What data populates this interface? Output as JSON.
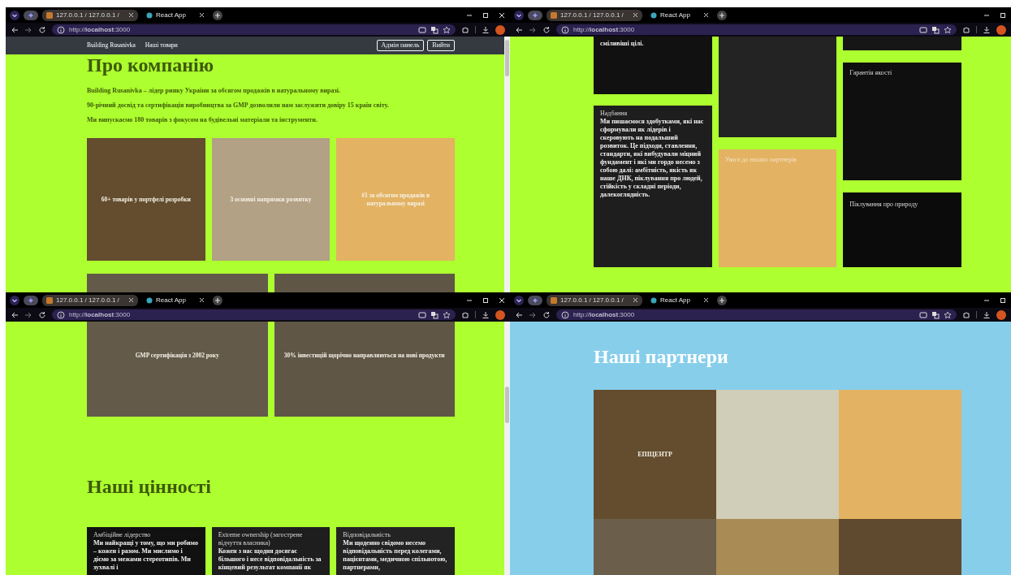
{
  "windows": [
    {
      "tabs": [
        {
          "title": "127.0.0.1 / 127.0.0.1 /",
          "selected": false
        },
        {
          "title": "React App",
          "selected": true
        }
      ],
      "url": "http://**localhost**:3000",
      "blocks": [
        {
          "kind": "navbar",
          "links": [
            "Building Rusanivka",
            "Наші товари"
          ],
          "buttons": [
            "Адмін панель",
            "Вийти"
          ]
        },
        {
          "kind": "heading",
          "text": "Про компанію"
        },
        {
          "kind": "paragraphs",
          "items": [
            "Building Rusanivka – лідер ринку України за обсягом продажів в натуральному виразі.",
            "90-річний досвід та сертифікація виробництва за GMP дозволили нам заслужити довіру 15 країн світу.",
            "Ми випускаємо 180 товарів з фокусом на будівельні матеріали та інструменти."
          ]
        },
        {
          "kind": "tiles",
          "tiles": [
            {
              "text": "60+ товарів у портфелі розробки",
              "color": "#634d2e"
            },
            {
              "text": "3 основні напрямки розвитку",
              "color": "#b2a185"
            },
            {
              "text": "#1 за обсягом продажів в натуральному виразі",
              "color": "#e3b262"
            }
          ]
        },
        {
          "kind": "tiles",
          "tiles": [
            {
              "color": "#635a4a"
            },
            {
              "color": "#5f5646"
            }
          ]
        }
      ]
    },
    {
      "tabs": [
        {
          "title": "127.0.0.1 / 127.0.0.1 /",
          "selected": false
        },
        {
          "title": "React App",
          "selected": true
        }
      ],
      "url": "http://**localhost**:3000",
      "blocks": [
        {
          "kind": "value_cards",
          "columns": [
            {
              "cards": [
                {
                  "text": "сміливіші цілі.",
                  "color": "#111111"
                },
                {
                  "title": "Надбання",
                  "text": "Ми пишаємося здобутками, які нас сформували як лідерів і скеровують на подальший розвиток. Це підходи, ставлення, стандарти, які вибудували міцний фундамент і які ми гордо несемо з собою далі: амбітність, якість як наше ДНК, піклування про людей, стійкість у складні періоди, далекоглядність.",
                  "color": "#1e1e1e"
                }
              ]
            },
            {
              "cards": [
                {
                  "color": "#232323"
                },
                {
                  "title": "Увага до наших партнерів",
                  "color": "#e3b262"
                }
              ]
            },
            {
              "cards": [
                {
                  "color": "#161616"
                },
                {
                  "title": "Гарантія якості",
                  "color": "#0f0f0f"
                },
                {
                  "title": "Піклування про природу",
                  "color": "#0b0b0b"
                }
              ]
            }
          ]
        }
      ]
    },
    {
      "tabs": [
        {
          "title": "127.0.0.1 / 127.0.0.1 /",
          "selected": false
        },
        {
          "title": "React App",
          "selected": true
        }
      ],
      "url": "http://**localhost**:3000",
      "blocks": [
        {
          "kind": "tiles",
          "tiles": [
            {
              "text": "GMP сертифікація з 2002 року",
              "color": "#635a4a"
            },
            {
              "text": "30% інвестицій щорічно направляються на нові продукти",
              "color": "#5f5646"
            }
          ]
        },
        {
          "kind": "heading",
          "text": "Наші цінності"
        },
        {
          "kind": "value_cards",
          "columns": [
            {
              "cards": [
                {
                  "title": "Амбіційне лідерство",
                  "text": "Ми найкращі у тому, що ми робимо – кожен і разом. Ми мислимо і діємо за межами стереотипів. Ми зухвалі і",
                  "color": "#111111"
                }
              ]
            },
            {
              "cards": [
                {
                  "title": "Extreme ownership (загострене відчуття власника)",
                  "text": "Кожен з нас щодня досягає більшого і несе відповідальність за кінцевий результат компанії як",
                  "color": "#1e1e1e"
                }
              ]
            },
            {
              "cards": [
                {
                  "title": "Відповідальність",
                  "text": "Ми щоденно свідомо несемо відповідальність перед колегами, пацієнтами, медичною спільнотою, партнерами,",
                  "color": "#232323"
                }
              ]
            }
          ]
        }
      ]
    },
    {
      "tabs": [
        {
          "title": "127.0.0.1 / 127.0.0.1 /",
          "selected": false
        },
        {
          "title": "React App",
          "selected": true
        }
      ],
      "url": "http://**localhost**:3000",
      "blocks": [
        {
          "kind": "heading",
          "text": "Наші партнери"
        },
        {
          "kind": "partners",
          "tiles": [
            {
              "text": "ЕПІЦЕНТР",
              "color": "#634d2e"
            },
            {
              "color": "#d0cdb8"
            },
            {
              "color": "#e3b262"
            },
            {
              "color": "#6b5e4b"
            },
            {
              "color": "#a98b55"
            },
            {
              "color": "#5f4a2f"
            }
          ]
        }
      ]
    }
  ]
}
